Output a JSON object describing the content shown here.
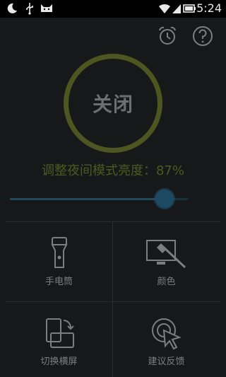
{
  "status_bar": {
    "time": "5:24",
    "icons": [
      "moon-icon",
      "usb-icon",
      "cat-icon",
      "wifi-icon",
      "signal-icon",
      "battery-icon"
    ]
  },
  "toolbar": {
    "alarm_icon": "alarm-clock-icon",
    "help_icon": "help-icon"
  },
  "power": {
    "label": "关闭"
  },
  "brightness": {
    "label": "调整夜间模式亮度：87%",
    "value_percent": 87
  },
  "grid": {
    "items": [
      {
        "label": "手电筒",
        "icon": "flashlight-icon"
      },
      {
        "label": "颜色",
        "icon": "color-palette-icon"
      },
      {
        "label": "切换横屏",
        "icon": "rotate-screen-icon"
      },
      {
        "label": "建议反馈",
        "icon": "feedback-icon"
      }
    ]
  },
  "colors": {
    "background": "#161819",
    "ring": "#4e5521",
    "brightness_text": "#4e5a1f",
    "slider": "#1c4a63",
    "icon_gray": "#7b7f80"
  }
}
